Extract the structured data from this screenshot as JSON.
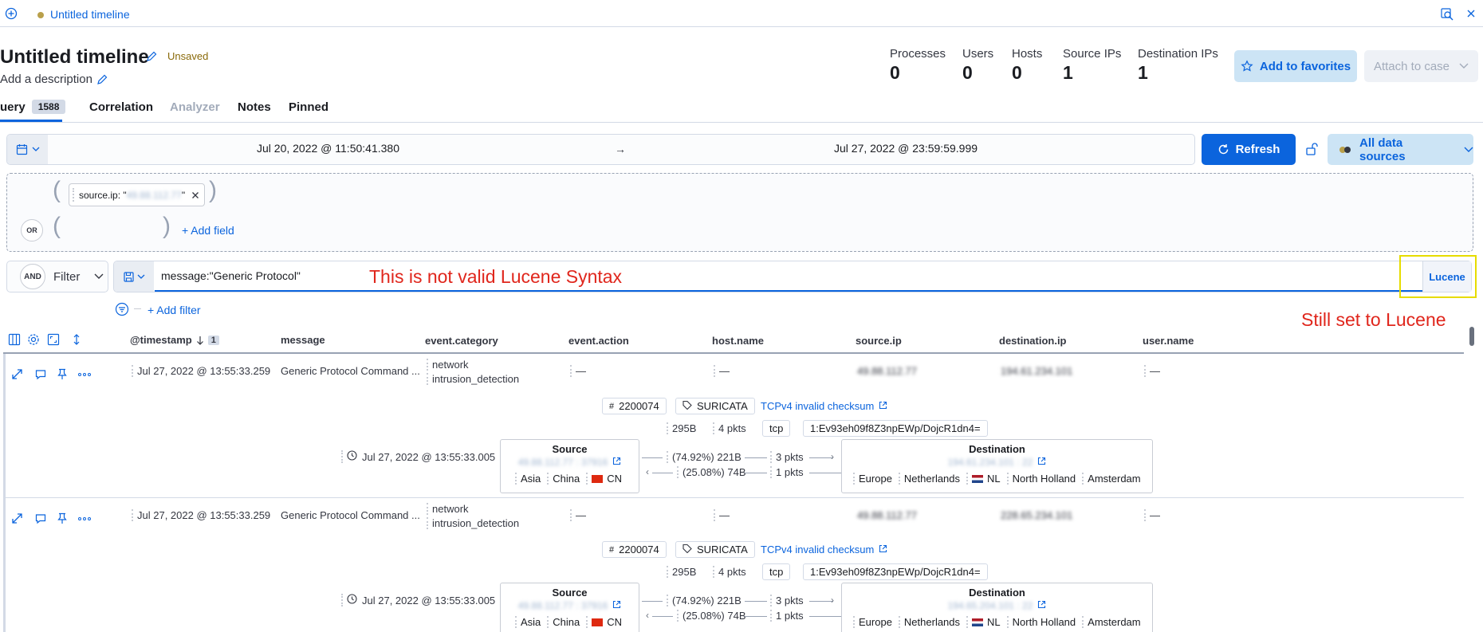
{
  "topbar": {
    "add_icon": "add-circle-icon",
    "status_dot_color": "#b9a04b",
    "tab_title": "Untitled timeline"
  },
  "header": {
    "title": "Untitled timeline",
    "status": "Unsaved",
    "description": "Add a description",
    "stats": [
      {
        "label": "Processes",
        "value": "0"
      },
      {
        "label": "Users",
        "value": "0"
      },
      {
        "label": "Hosts",
        "value": "0"
      },
      {
        "label": "Source IPs",
        "value": "1"
      },
      {
        "label": "Destination IPs",
        "value": "1"
      }
    ],
    "favorites_label": "Add to favorites",
    "case_label": "Attach to case"
  },
  "tabs": {
    "query": "uery",
    "query_count": "1588",
    "correlation": "Correlation",
    "analyzer": "Analyzer",
    "notes": "Notes",
    "pinned": "Pinned"
  },
  "datebar": {
    "start": "Jul 20, 2022 @ 11:50:41.380",
    "arrow": "→",
    "end": "Jul 27, 2022 @ 23:59:59.999",
    "refresh": "Refresh",
    "datasources": "All data sources"
  },
  "dataprovider": {
    "pill_text": "source.ip: \"49.88.112.77\"",
    "or_label": "OR",
    "add_field": "+ Add field"
  },
  "querybar": {
    "and_label": "AND",
    "filter_label": "Filter",
    "query": "message:\"Generic Protocol\"",
    "language": "Lucene",
    "add_filter": "+ Add filter"
  },
  "annotations": {
    "invalid_note": "This is not valid Lucene Syntax",
    "lucene_note": "Still set to Lucene",
    "note_color": "#e0261c",
    "box_color": "#e6dc00"
  },
  "columns": [
    "@timestamp",
    "message",
    "event.category",
    "event.action",
    "host.name",
    "source.ip",
    "destination.ip",
    "user.name"
  ],
  "sort_count": "1",
  "rows": [
    {
      "timestamp": "Jul 27, 2022 @ 13:55:33.259",
      "message": "Generic Protocol Command ...",
      "category1": "network",
      "category2": "intrusion_detection",
      "action": "—",
      "host": "—",
      "source_ip": "49.88.112.77",
      "dest_ip": "194.61.234.101",
      "user": "—",
      "sig_id": "2200074",
      "module": "SURICATA",
      "signature": "TCPv4 invalid checksum",
      "bytes": "295B",
      "pkts": "4 pkts",
      "proto": "tcp",
      "community_id": "1:Ev93eh09f8Z3npEWp/DojcR1dn4=",
      "event_time": "Jul 27, 2022 @ 13:55:33.005",
      "source_title": "Source",
      "source_addr": "49.88.112.77 : 37916",
      "src_geo": [
        "Asia",
        "China",
        "CN"
      ],
      "flow_out_pct": "(74.92%)",
      "flow_out_bytes": "221B",
      "flow_out_pkts": "3 pkts",
      "flow_in_pct": "(25.08%)",
      "flow_in_bytes": "74B",
      "flow_in_pkts": "1 pkts",
      "dest_title": "Destination",
      "dest_addr": "194.61.234.101 : 22",
      "dst_geo": [
        "Europe",
        "Netherlands",
        "NL",
        "North Holland",
        "Amsterdam"
      ]
    },
    {
      "timestamp": "Jul 27, 2022 @ 13:55:33.259",
      "message": "Generic Protocol Command ...",
      "category1": "network",
      "category2": "intrusion_detection",
      "action": "—",
      "host": "—",
      "source_ip": "49.88.112.77",
      "dest_ip": "228.65.234.101",
      "user": "—",
      "sig_id": "2200074",
      "module": "SURICATA",
      "signature": "TCPv4 invalid checksum",
      "bytes": "295B",
      "pkts": "4 pkts",
      "proto": "tcp",
      "community_id": "1:Ev93eh09f8Z3npEWp/DojcR1dn4=",
      "event_time": "Jul 27, 2022 @ 13:55:33.005",
      "source_title": "Source",
      "source_addr": "49.88.112.77 : 37916",
      "src_geo": [
        "Asia",
        "China",
        "CN"
      ],
      "flow_out_pct": "(74.92%)",
      "flow_out_bytes": "221B",
      "flow_out_pkts": "3 pkts",
      "flow_in_pct": "(25.08%)",
      "flow_in_bytes": "74B",
      "flow_in_pkts": "1 pkts",
      "dest_title": "Destination",
      "dest_addr": "194.65.204.101 : 22",
      "dst_geo": [
        "Europe",
        "Netherlands",
        "NL",
        "North Holland",
        "Amsterdam"
      ]
    }
  ]
}
